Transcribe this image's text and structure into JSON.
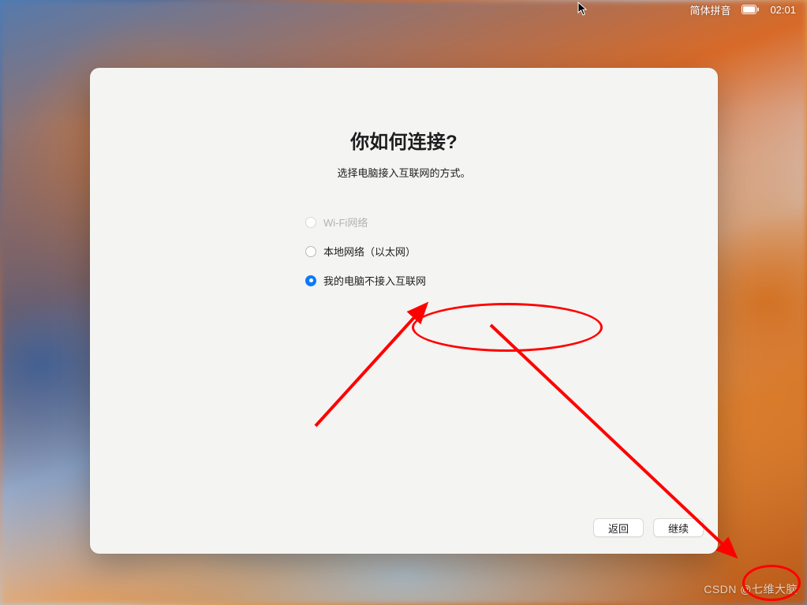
{
  "menubar": {
    "ime": "简体拼音",
    "time": "02:01"
  },
  "dialog": {
    "title": "你如何连接?",
    "subtitle": "选择电脑接入互联网的方式。",
    "options": {
      "wifi": {
        "label": "Wi-Fi网络",
        "enabled": false,
        "selected": false
      },
      "ethernet": {
        "label": "本地网络（以太网）",
        "enabled": true,
        "selected": false
      },
      "no_internet": {
        "label": "我的电脑不接入互联网",
        "enabled": true,
        "selected": true
      }
    },
    "buttons": {
      "back": "返回",
      "continue": "继续"
    }
  },
  "watermark": "CSDN @七维大脑",
  "colors": {
    "accent": "#0a7aff",
    "annotation": "#ff0000"
  }
}
